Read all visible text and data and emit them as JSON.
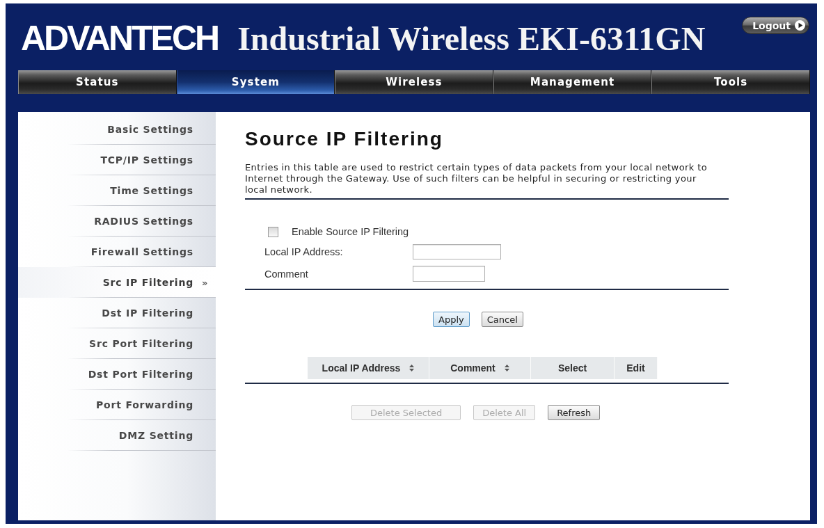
{
  "header": {
    "logo": "ADVANTECH",
    "title": "Industrial Wireless EKI-6311GN",
    "logout": "Logout"
  },
  "tabs": [
    {
      "label": "Status",
      "selected": false
    },
    {
      "label": "System",
      "selected": true
    },
    {
      "label": "Wireless",
      "selected": false
    },
    {
      "label": "Management",
      "selected": false
    },
    {
      "label": "Tools",
      "selected": false
    }
  ],
  "sidebar": {
    "current_marker": "»",
    "items": [
      {
        "label": "Basic Settings",
        "selected": false
      },
      {
        "label": "TCP/IP Settings",
        "selected": false
      },
      {
        "label": "Time Settings",
        "selected": false
      },
      {
        "label": "RADIUS Settings",
        "selected": false
      },
      {
        "label": "Firewall Settings",
        "selected": false
      },
      {
        "label": "Src IP Filtering",
        "selected": true
      },
      {
        "label": "Dst IP Filtering",
        "selected": false
      },
      {
        "label": "Src Port Filtering",
        "selected": false
      },
      {
        "label": "Dst Port Filtering",
        "selected": false
      },
      {
        "label": "Port Forwarding",
        "selected": false
      },
      {
        "label": "DMZ Setting",
        "selected": false
      }
    ]
  },
  "page": {
    "title": "Source IP Filtering",
    "description": "Entries in this table are used to restrict certain types of data packets from your local network to Internet through the Gateway. Use of such filters can be helpful in securing or restricting your local network.",
    "enable": {
      "label": "Enable Source IP Filtering",
      "checked": false
    },
    "fields": [
      {
        "label": "Local IP Address:"
      },
      {
        "label": "Comment"
      }
    ]
  },
  "form_buttons": [
    {
      "label": "Apply",
      "focused": true
    },
    {
      "label": "Cancel",
      "focused": false
    }
  ],
  "table": {
    "columns": [
      {
        "label": "Local IP Address",
        "sortable": true
      },
      {
        "label": "Comment",
        "sortable": true
      },
      {
        "label": "Select",
        "sortable": false
      },
      {
        "label": "Edit",
        "sortable": false
      }
    ]
  },
  "list_buttons": [
    {
      "label": "Delete Selected",
      "disabled": true
    },
    {
      "label": "Delete All",
      "disabled": true
    },
    {
      "label": "Refresh",
      "disabled": false
    }
  ]
}
